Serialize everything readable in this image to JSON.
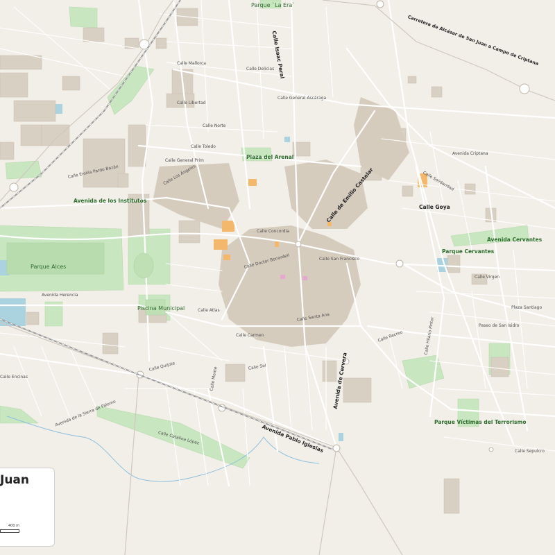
{
  "map": {
    "title": "Juan",
    "scale": "400 m",
    "colors": {
      "background": "#f2efe9",
      "road": "#ffffff",
      "road_casing": "#cfc8bd",
      "building": "#d9d0c4",
      "park": "#c8e6c0",
      "water": "#aad3df",
      "rail": "#9a9a9a",
      "highlight_orange": "#f3b86b",
      "highlight_pink": "#e7a8cf"
    },
    "labels": {
      "parque_la_era": "Parque `La Era`",
      "carretera": "Carretera de Alcázar de San Juan a Campo de Criptana",
      "calle_isaac_peral": "Calle Isaac Peral",
      "avenida_criptana": "Avenida Criptana",
      "plaza_del_arenal": "Plaza del Arenal",
      "avenida_institutos": "Avenida de los Institutos",
      "calle_emilio_castelar": "Calle de Emilio Castelar",
      "calle_goya": "Calle Goya",
      "parque_cervantes": "Parque Cervantes",
      "avenida_cervantes": "Avenida Cervantes",
      "parque_alces": "Parque Alces",
      "avenida_herencia": "Avenida Herencia",
      "piscina_municipal": "Piscina Municipal",
      "avenida_pablo_iglesias": "Avenida Pablo Iglesias",
      "avenida_de_cervera": "Avenida de Cervera",
      "parque_victimas": "Parque Víctimas del Terrorismo",
      "avenida_sierra_palomo": "Avenida de la Sierra de Palomo",
      "calle_emilia_pardo_bazan": "Calle Emilia Pardo Bazán",
      "calle_concordia": "Calle Concordia",
      "calle_san_francisco": "Calle San Francisco",
      "calle_santa_ana": "Calle Santa Ana",
      "calle_carmen": "Calle Carmen",
      "calle_gral_prim": "Calle General Prim",
      "calle_los_angeles": "Calle Los Ángeles",
      "calle_norte": "Calle Norte",
      "calle_liberdad": "Calle Libertad",
      "calle_dr_bonardell": "Calle Doctor Bonardell",
      "calle_toledo": "Calle Toledo",
      "calle_mallorca": "Calle Mallorca",
      "calle_delicias": "Calle Delicias",
      "calle_gral_arcaraga": "Calle General Ascáraga",
      "calle_sol": "Calle Sol",
      "calle_hilario_pintor": "Calle Hilario Pintor",
      "calle_virgen": "Calle Virgen",
      "paseo_san_isidro": "Paseo de San Isidro",
      "calle_sepulcro": "Calle Sepulcro",
      "calle_catalina_lopez": "Calle Catalina López",
      "calle_atlas": "Calle Atlas",
      "calle_recreo": "Calle Recreo",
      "calle_solidaridad": "Calle Solidaridad",
      "plaza_santiago": "Plaza Santiago",
      "calle_quijote": "Calle Quijote",
      "calle_monte": "Calle Monte",
      "calle_ancinas": "Calle Encinas"
    }
  }
}
